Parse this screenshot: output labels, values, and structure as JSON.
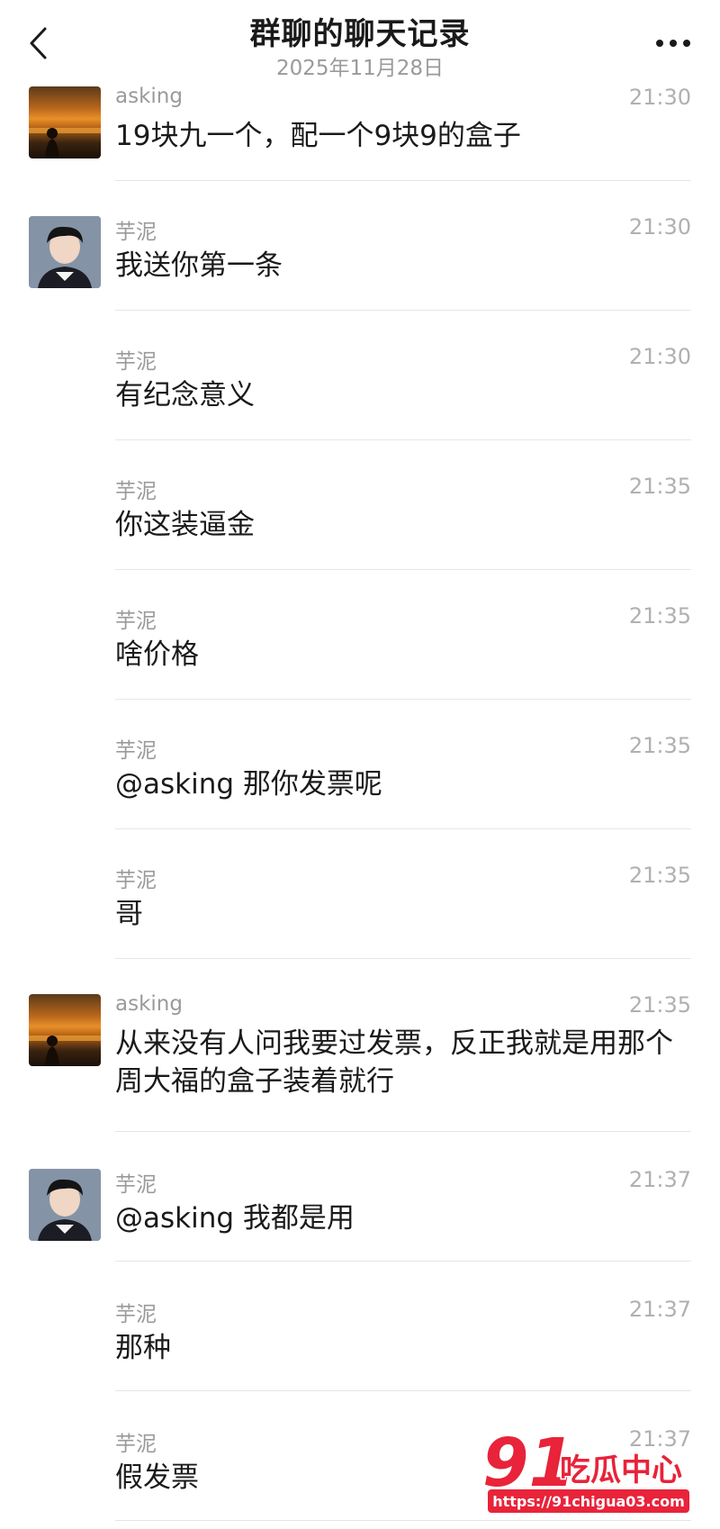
{
  "header": {
    "title": "群聊的聊天记录",
    "subtitle": "2025年11月28日"
  },
  "messages": [
    {
      "sender": "asking",
      "time": "21:30",
      "text": "19块九一个，配一个9块9的盒子",
      "avatar": "sunset"
    },
    {
      "sender": "芋泥",
      "time": "21:30",
      "text": "我送你第一条",
      "avatar": "person"
    },
    {
      "sender": "芋泥",
      "time": "21:30",
      "text": "有纪念意义",
      "avatar": ""
    },
    {
      "sender": "芋泥",
      "time": "21:35",
      "text": "你这装逼金",
      "avatar": ""
    },
    {
      "sender": "芋泥",
      "time": "21:35",
      "text": "啥价格",
      "avatar": ""
    },
    {
      "sender": "芋泥",
      "time": "21:35",
      "text": "@asking 那你发票呢",
      "avatar": ""
    },
    {
      "sender": "芋泥",
      "time": "21:35",
      "text": "哥",
      "avatar": ""
    },
    {
      "sender": "asking",
      "time": "21:35",
      "text": "从来没有人问我要过发票，反正我就是用那个周大福的盒子装着就行",
      "avatar": "sunset"
    },
    {
      "sender": "芋泥",
      "time": "21:37",
      "text": "@asking 我都是用",
      "avatar": "person"
    },
    {
      "sender": "芋泥",
      "time": "21:37",
      "text": "那种",
      "avatar": ""
    },
    {
      "sender": "芋泥",
      "time": "21:37",
      "text": "假发票",
      "avatar": ""
    }
  ],
  "watermark": {
    "logo_number": "91",
    "logo_text": "吃瓜中心",
    "url": "https://91chigua03.com"
  },
  "colors": {
    "watermark_red": "#e8233a",
    "divider": "#e6e6e6",
    "meta_gray": "#9a9a9a"
  }
}
